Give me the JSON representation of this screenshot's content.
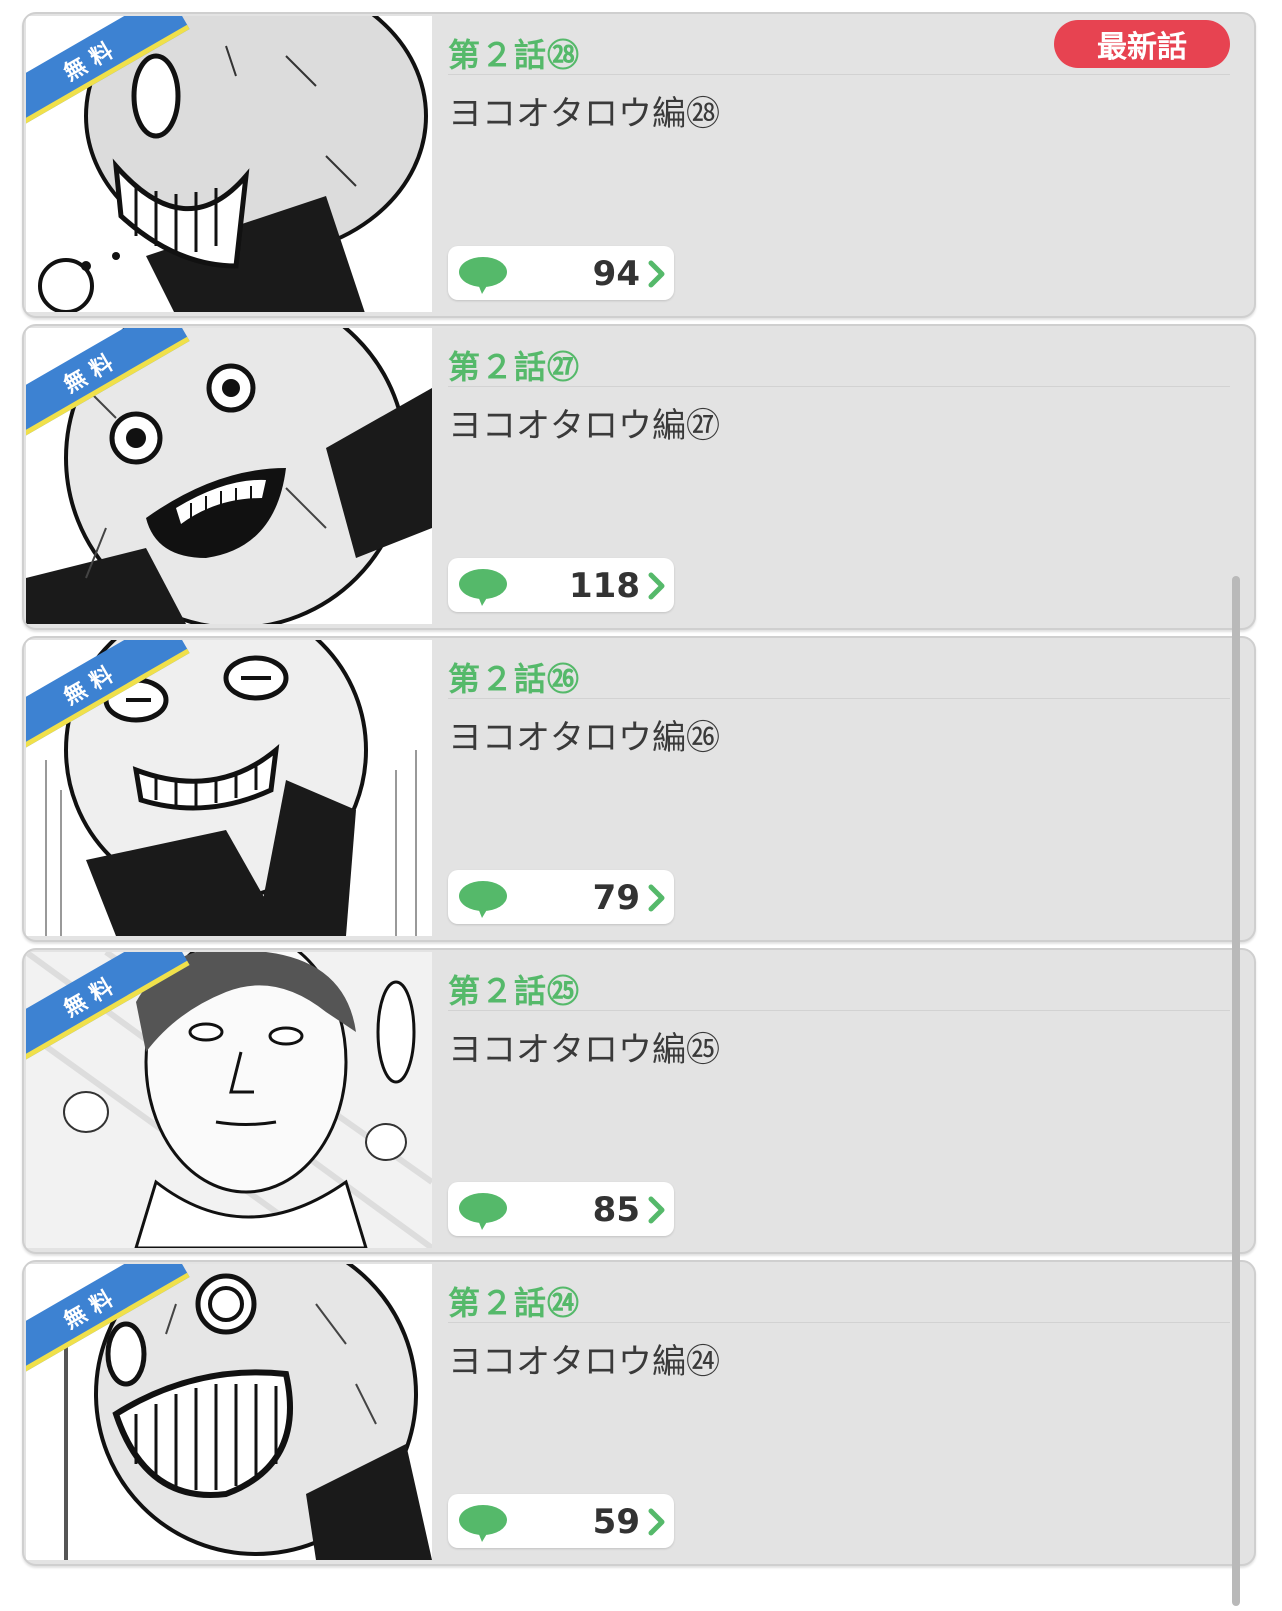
{
  "colors": {
    "accent_green": "#55b96a",
    "badge_red": "#e74351",
    "ribbon_blue": "#3d82d2",
    "ribbon_yellow": "#f0e04a",
    "card_bg": "#e3e3e3"
  },
  "episodes": [
    {
      "free_label": "無料",
      "number": "第２話㉘",
      "title": "ヨコオタロウ編㉘",
      "comments": "94",
      "latest_badge": "最新話",
      "comment_icon": "speech-bubble-icon",
      "chevron_icon": "chevron-right-icon"
    },
    {
      "free_label": "無料",
      "number": "第２話㉗",
      "title": "ヨコオタロウ編㉗",
      "comments": "118",
      "comment_icon": "speech-bubble-icon",
      "chevron_icon": "chevron-right-icon"
    },
    {
      "free_label": "無料",
      "number": "第２話㉖",
      "title": "ヨコオタロウ編㉖",
      "comments": "79",
      "comment_icon": "speech-bubble-icon",
      "chevron_icon": "chevron-right-icon"
    },
    {
      "free_label": "無料",
      "number": "第２話㉕",
      "title": "ヨコオタロウ編㉕",
      "comments": "85",
      "comment_icon": "speech-bubble-icon",
      "chevron_icon": "chevron-right-icon"
    },
    {
      "free_label": "無料",
      "number": "第２話㉔",
      "title": "ヨコオタロウ編㉔",
      "comments": "59",
      "comment_icon": "speech-bubble-icon",
      "chevron_icon": "chevron-right-icon"
    }
  ]
}
